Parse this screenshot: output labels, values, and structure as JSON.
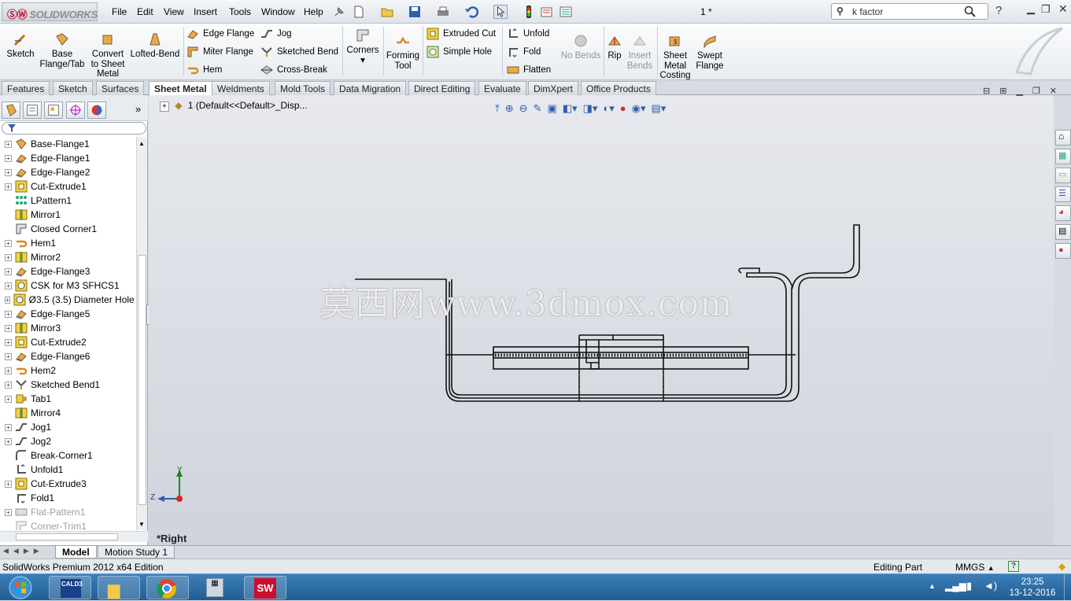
{
  "app": {
    "logo_text": "SOLIDWORKS",
    "doc_title": "1 *"
  },
  "menu": [
    "File",
    "Edit",
    "View",
    "Insert",
    "Tools",
    "Window",
    "Help"
  ],
  "search": {
    "value": "k factor"
  },
  "ribbon": {
    "sketch": "Sketch",
    "base_flange": [
      "Base",
      "Flange/Tab"
    ],
    "convert": [
      "Convert",
      "to Sheet",
      "Metal"
    ],
    "lofted": "Lofted-Bend",
    "edge_flange": "Edge Flange",
    "miter_flange": "Miter Flange",
    "hem": "Hem",
    "jog": "Jog",
    "sketched_bend": "Sketched Bend",
    "cross_break": "Cross-Break",
    "corners": "Corners",
    "forming": [
      "Forming",
      "Tool"
    ],
    "extruded_cut": "Extruded Cut",
    "simple_hole": "Simple Hole",
    "unfold": "Unfold",
    "fold": "Fold",
    "flatten": "Flatten",
    "no_bends": "No Bends",
    "rip": "Rip",
    "insert_bends": [
      "Insert",
      "Bends"
    ],
    "costing": [
      "Sheet",
      "Metal",
      "Costing"
    ],
    "swept": [
      "Swept",
      "Flange"
    ]
  },
  "tabs": [
    "Features",
    "Sketch",
    "Surfaces",
    "Sheet Metal",
    "Weldments",
    "Mold Tools",
    "Data Migration",
    "Direct Editing",
    "Evaluate",
    "DimXpert",
    "Office Products"
  ],
  "active_tab": "Sheet Metal",
  "tree": [
    {
      "label": "Base-Flange1",
      "icon": "base-flange-icon",
      "exp": true
    },
    {
      "label": "Edge-Flange1",
      "icon": "edge-flange-icon",
      "exp": true
    },
    {
      "label": "Edge-Flange2",
      "icon": "edge-flange-icon",
      "exp": true
    },
    {
      "label": "Cut-Extrude1",
      "icon": "cut-extrude-icon",
      "exp": true
    },
    {
      "label": "LPattern1",
      "icon": "linear-pattern-icon",
      "exp": false
    },
    {
      "label": "Mirror1",
      "icon": "mirror-icon",
      "exp": false
    },
    {
      "label": "Closed Corner1",
      "icon": "closed-corner-icon",
      "exp": false
    },
    {
      "label": "Hem1",
      "icon": "hem-icon",
      "exp": true
    },
    {
      "label": "Mirror2",
      "icon": "mirror-icon",
      "exp": true
    },
    {
      "label": "Edge-Flange3",
      "icon": "edge-flange-icon",
      "exp": true
    },
    {
      "label": "CSK for M3 SFHCS1",
      "icon": "hole-wizard-icon",
      "exp": true
    },
    {
      "label": "Ø3.5 (3.5) Diameter Hole1",
      "icon": "hole-wizard-icon",
      "exp": true
    },
    {
      "label": "Edge-Flange5",
      "icon": "edge-flange-icon",
      "exp": true
    },
    {
      "label": "Mirror3",
      "icon": "mirror-icon",
      "exp": true
    },
    {
      "label": "Cut-Extrude2",
      "icon": "cut-extrude-icon",
      "exp": true
    },
    {
      "label": "Edge-Flange6",
      "icon": "edge-flange-icon",
      "exp": true
    },
    {
      "label": "Hem2",
      "icon": "hem-icon",
      "exp": true
    },
    {
      "label": "Sketched Bend1",
      "icon": "sketched-bend-icon",
      "exp": true
    },
    {
      "label": "Tab1",
      "icon": "tab-icon",
      "exp": true
    },
    {
      "label": "Mirror4",
      "icon": "mirror-icon",
      "exp": false
    },
    {
      "label": "Jog1",
      "icon": "jog-icon",
      "exp": true
    },
    {
      "label": "Jog2",
      "icon": "jog-icon",
      "exp": true
    },
    {
      "label": "Break-Corner1",
      "icon": "break-corner-icon",
      "exp": false
    },
    {
      "label": "Unfold1",
      "icon": "unfold-icon",
      "exp": false
    },
    {
      "label": "Cut-Extrude3",
      "icon": "cut-extrude-icon",
      "exp": true
    },
    {
      "label": "Fold1",
      "icon": "fold-icon",
      "exp": false
    },
    {
      "label": "Flat-Pattern1",
      "icon": "flat-pattern-icon",
      "exp": true,
      "gray": true
    },
    {
      "label": "Corner-Trim1",
      "icon": "corner-trim-icon",
      "exp": false,
      "gray": true
    }
  ],
  "graphics": {
    "breadcrumb": "1  (Default<<Default>_Disp...",
    "view_label": "*Right",
    "watermark": "莫西网www.3dmox.com",
    "axis_y": "Y",
    "axis_z": "Z"
  },
  "bottom_tabs": [
    "Model",
    "Motion Study 1"
  ],
  "status": {
    "edition": "SolidWorks Premium 2012 x64 Edition",
    "mode": "Editing Part",
    "units": "MMGS"
  },
  "taskbar": {
    "time": "23:25",
    "date": "13-12-2016",
    "cald_label": "CALD3"
  },
  "colors": {
    "accent_red": "#c8102e",
    "taskbar": "#2a6aa3"
  }
}
